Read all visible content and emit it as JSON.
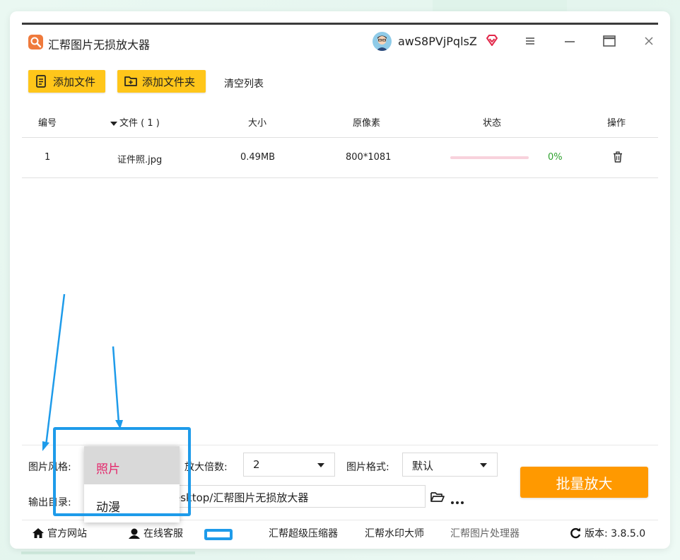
{
  "app": {
    "title": "汇帮图片无损放大器",
    "username": "awS8PVjPqlsZ"
  },
  "toolbar": {
    "add_file": "添加文件",
    "add_folder": "添加文件夹",
    "clear_list": "清空列表"
  },
  "table": {
    "headers": {
      "id": "编号",
      "file": "文件 ( 1 )",
      "size": "大小",
      "pixels": "原像素",
      "status": "状态",
      "action": "操作"
    },
    "rows": [
      {
        "id": "1",
        "file": "证件照.jpg",
        "size": "0.49MB",
        "pixels": "800*1081",
        "progress": 0,
        "percent": "0%"
      }
    ]
  },
  "settings": {
    "style_label": "图片风格:",
    "scale_label": "放大倍数:",
    "scale_value": "2",
    "format_label": "图片格式:",
    "format_value": "默认",
    "output_label": "输出目录:",
    "output_path": "esktop/汇帮图片无损放大器",
    "batch_button": "批量放大"
  },
  "style_dropdown": {
    "options": [
      "照片",
      "动漫"
    ],
    "selected": "照片"
  },
  "footer": {
    "website": "官方网站",
    "support": "在线客服",
    "compressor": "汇帮超级压缩器",
    "watermark": "汇帮水印大师",
    "processor": "汇帮图片处理器",
    "version": "版本: 3.8.5.0"
  },
  "colors": {
    "accent_yellow": "#ffc61a",
    "batch_orange": "#ff9900",
    "annotation_blue": "#1e9bea",
    "selected_pink": "#e4256a",
    "percent_green": "#2ea12e"
  }
}
